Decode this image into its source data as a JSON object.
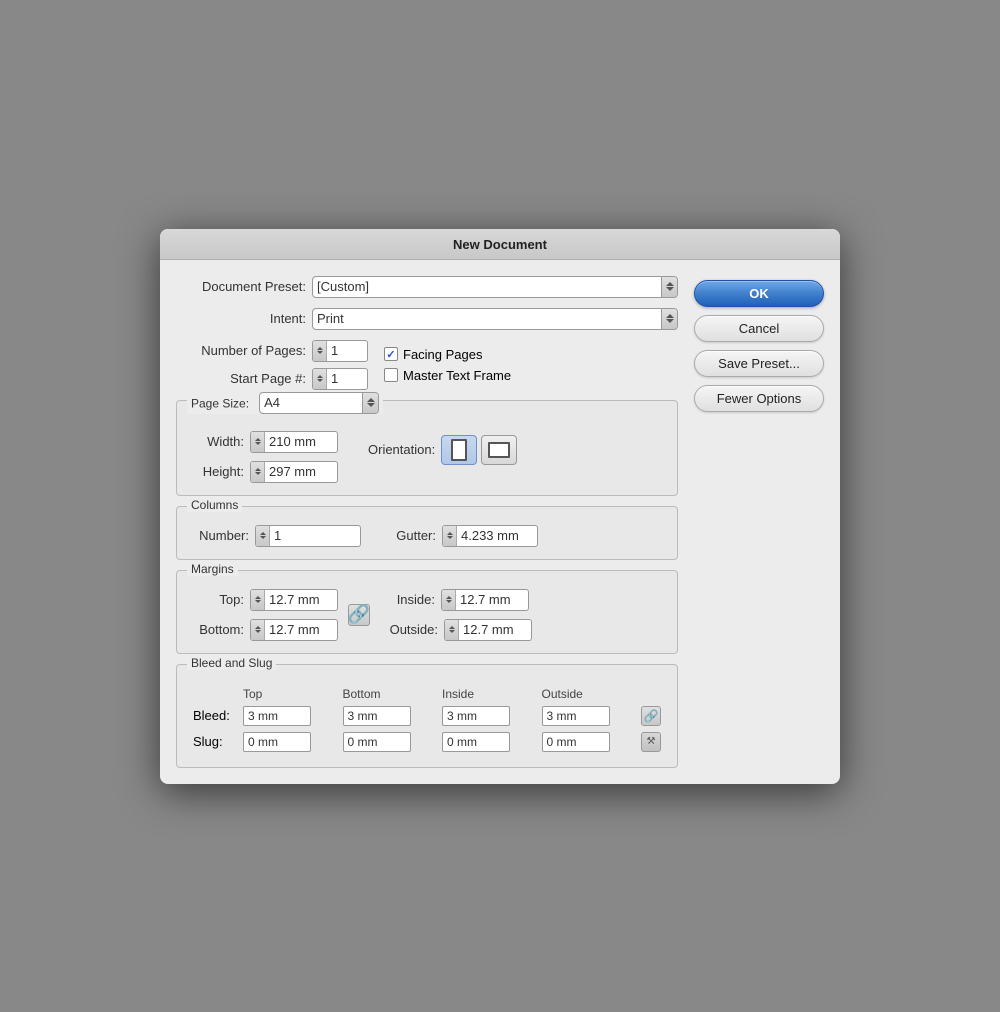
{
  "dialog": {
    "title": "New Document"
  },
  "form": {
    "document_preset_label": "Document Preset:",
    "document_preset_value": "[Custom]",
    "intent_label": "Intent:",
    "intent_value": "Print",
    "num_pages_label": "Number of Pages:",
    "num_pages_value": "1",
    "start_page_label": "Start Page #:",
    "start_page_value": "1",
    "facing_pages_label": "Facing Pages",
    "master_text_frame_label": "Master Text Frame",
    "page_size_label": "Page Size:",
    "page_size_value": "A4",
    "width_label": "Width:",
    "width_value": "210 mm",
    "height_label": "Height:",
    "height_value": "297 mm",
    "orientation_label": "Orientation:",
    "columns_label": "Columns",
    "col_number_label": "Number:",
    "col_number_value": "1",
    "gutter_label": "Gutter:",
    "gutter_value": "4.233 mm",
    "margins_label": "Margins",
    "margin_top_label": "Top:",
    "margin_top_value": "12.7 mm",
    "margin_bottom_label": "Bottom:",
    "margin_bottom_value": "12.7 mm",
    "margin_inside_label": "Inside:",
    "margin_inside_value": "12.7 mm",
    "margin_outside_label": "Outside:",
    "margin_outside_value": "12.7 mm",
    "bleed_slug_label": "Bleed and Slug",
    "bleed_label": "Bleed:",
    "slug_label": "Slug:",
    "col_top": "Top",
    "col_bottom": "Bottom",
    "col_inside": "Inside",
    "col_outside": "Outside",
    "bleed_top": "3 mm",
    "bleed_bottom": "3 mm",
    "bleed_inside": "3 mm",
    "bleed_outside": "3 mm",
    "slug_top": "0 mm",
    "slug_bottom": "0 mm",
    "slug_inside": "0 mm",
    "slug_outside": "0 mm"
  },
  "buttons": {
    "ok": "OK",
    "cancel": "Cancel",
    "save_preset": "Save Preset...",
    "fewer_options": "Fewer Options"
  }
}
